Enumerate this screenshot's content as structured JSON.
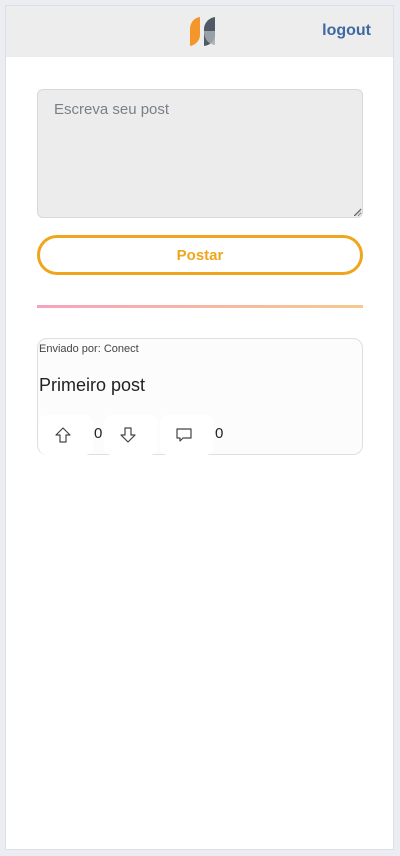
{
  "header": {
    "logo_icon": "conect-logo-icon",
    "logout_label": "logout",
    "colors": {
      "logo_left": "#f4962a",
      "logo_right": "#4f5a66",
      "link": "#3f69a3"
    }
  },
  "composer": {
    "placeholder": "Escreva seu post",
    "submit_label": "Postar",
    "accent_color": "#f0a61c"
  },
  "posts": [
    {
      "sender": "Enviado por: Conect",
      "text": "Primeiro post",
      "upvote_icon": "arrow-up-icon",
      "downvote_icon": "arrow-down-icon",
      "comment_icon": "comment-icon",
      "votes": "0",
      "comments": "0"
    }
  ]
}
